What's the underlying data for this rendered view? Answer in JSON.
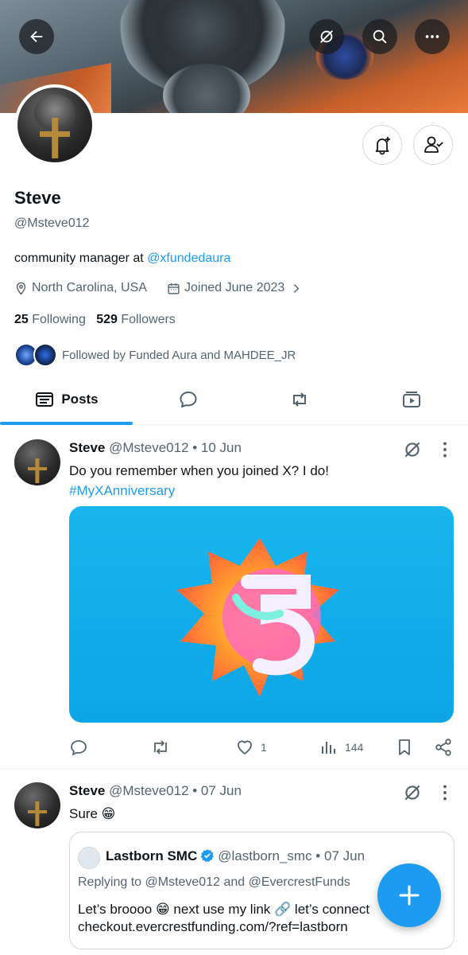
{
  "header": {
    "back_icon": "arrow-left-icon",
    "grok_icon": "grok-slash-icon",
    "search_icon": "search-icon",
    "more_icon": "more-dots-icon"
  },
  "profile": {
    "name": "Steve",
    "handle": "@Msteve012",
    "bio_prefix": "community manager at ",
    "bio_link": "@xfundedaura",
    "location": "North Carolina, USA",
    "joined": "Joined June 2023",
    "following_count": "25",
    "following_label": "Following",
    "followers_count": "529",
    "followers_label": "Followers",
    "followed_by": "Followed by Funded Aura and MAHDEE_JR"
  },
  "tabs": [
    {
      "label": "Posts",
      "icon": "posts-icon",
      "active": true
    },
    {
      "label": "",
      "icon": "replies-icon"
    },
    {
      "label": "",
      "icon": "reposts-icon"
    },
    {
      "label": "",
      "icon": "media-icon"
    }
  ],
  "posts": [
    {
      "author": "Steve",
      "handle_date": "@Msteve012 • 10 Jun",
      "text": "Do you remember when you joined X? I do!",
      "hashtag": "#MyXAnniversary",
      "likes": "1",
      "views": "144"
    },
    {
      "author": "Steve",
      "handle_date": "@Msteve012 • 07 Jun",
      "text": "Sure 😁",
      "quote": {
        "author": "Lastborn SMC",
        "handle_date": "@lastborn_smc • 07 Jun",
        "replying": "Replying to @Msteve012 and @EvercrestFunds",
        "text_line1": "Let’s broooo 😁 next use my link 🔗 let’s connect",
        "text_line2": "checkout.evercrestfunding.com/?ref=lastborn"
      }
    }
  ],
  "colors": {
    "accent": "#1d9bf0",
    "text_primary": "#0f1419",
    "text_secondary": "#536471"
  }
}
